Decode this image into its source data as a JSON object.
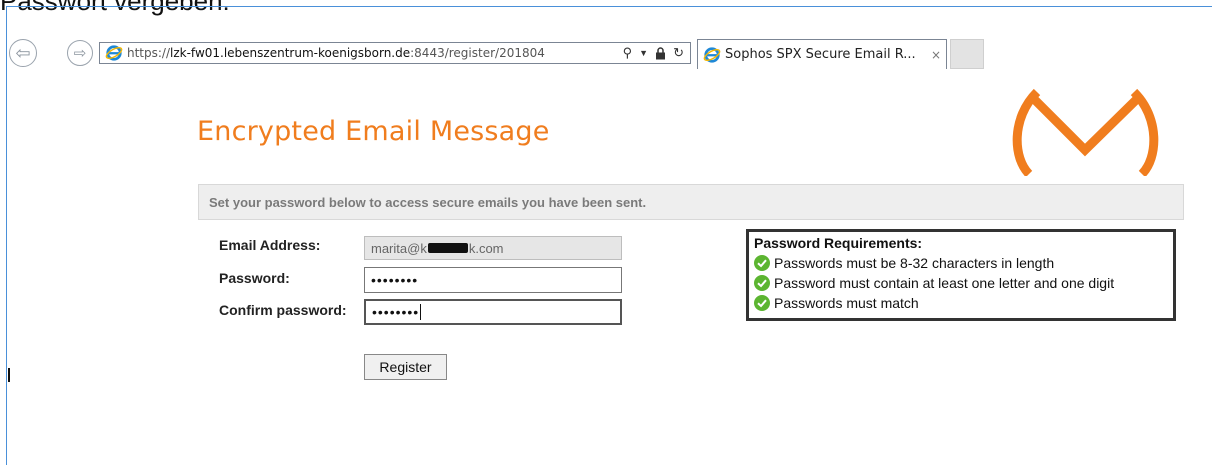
{
  "caption": "Passwort vergeben:",
  "browser": {
    "back_icon": "back-arrow-icon",
    "forward_icon": "forward-arrow-icon",
    "url_scheme": "https://",
    "url_host": "lzk-fw01.lebenszentrum-koenigsborn.de",
    "url_rest": ":8443/register/201804",
    "tab_title": "Sophos SPX Secure Email R...",
    "tab_close": "×"
  },
  "page": {
    "title": "Encrypted Email Message",
    "info": "Set your password below to access secure emails you have been sent."
  },
  "form": {
    "email_label": "Email Address:",
    "email_prefix": "marita@k",
    "email_suffix": "k.com",
    "password_label": "Password:",
    "password_value": "••••••••",
    "confirm_label": "Confirm password:",
    "confirm_value": "••••••••",
    "register_label": "Register"
  },
  "requirements": {
    "title": "Password Requirements:",
    "items": [
      "Passwords must be 8-32 characters in length",
      "Password must contain at least one letter and one digit",
      "Passwords must match"
    ]
  },
  "colors": {
    "brand_orange": "#f07d1e",
    "check_green": "#5cb531"
  }
}
